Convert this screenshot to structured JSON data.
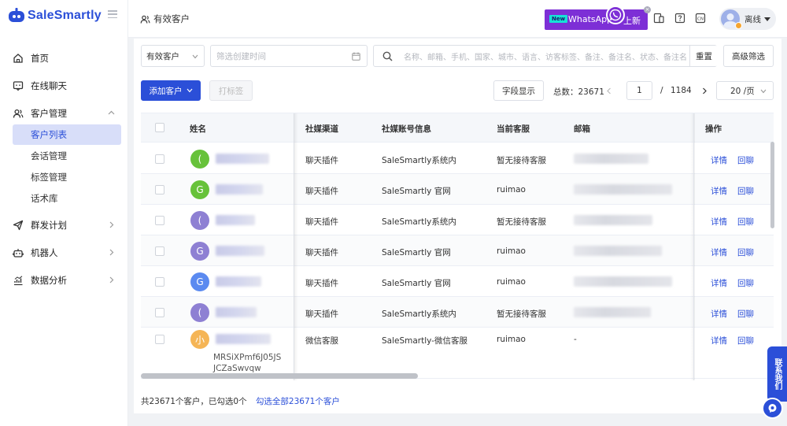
{
  "brand": {
    "name": "SaleSmartly",
    "color": "#2b4fd8"
  },
  "sidebar": {
    "items": [
      {
        "label": "首页",
        "icon": "home-icon"
      },
      {
        "label": "在线聊天",
        "icon": "chat-icon"
      },
      {
        "label": "客户管理",
        "icon": "users-icon",
        "expanded": true,
        "children": [
          "客户列表",
          "会话管理",
          "标签管理",
          "话术库"
        ],
        "active_child": "客户列表"
      },
      {
        "label": "群发计划",
        "icon": "send-icon"
      },
      {
        "label": "机器人",
        "icon": "robot-icon"
      },
      {
        "label": "数据分析",
        "icon": "analytics-icon"
      }
    ]
  },
  "header": {
    "breadcrumb": "有效客户",
    "banner": {
      "badge": "New",
      "text1": "WhatsApp",
      "text2": "上新"
    },
    "status": "离线"
  },
  "filters": {
    "customer_type": "有效客户",
    "date_placeholder": "筛选创建时间",
    "search_placeholder": "名称、邮箱、手机、国家、城市、语言、访客标签、备注、备注名、状态、备注名",
    "reset": "重置",
    "advanced": "高级筛选"
  },
  "toolbar": {
    "add_customer": "添加客户",
    "tag": "打标签",
    "fields": "字段显示",
    "total_label": "总数：",
    "total": "23671",
    "page": "1",
    "page_sep": "/",
    "total_pages": "1184",
    "page_size": "20 /页"
  },
  "table": {
    "headers": [
      "姓名",
      "社媒渠道",
      "社媒账号信息",
      "当前客服",
      "邮箱",
      "操作"
    ],
    "action_detail": "详情",
    "action_reply": "回聊",
    "rows": [
      {
        "initial": "(",
        "color": "#67c23a",
        "channel": "聊天插件",
        "account": "SaleSmartly系统内",
        "agent": "暂无接待客服",
        "email": ""
      },
      {
        "initial": "G",
        "color": "#67c23a",
        "channel": "聊天插件",
        "account": "SaleSmartly 官网",
        "agent": "ruimao",
        "email": ""
      },
      {
        "initial": "(",
        "color": "#8e80d3",
        "channel": "聊天插件",
        "account": "SaleSmartly系统内",
        "agent": "暂无接待客服",
        "email": ""
      },
      {
        "initial": "G",
        "color": "#8e80d3",
        "channel": "聊天插件",
        "account": "SaleSmartly 官网",
        "agent": "ruimao",
        "email": ""
      },
      {
        "initial": "G",
        "color": "#5b8af0",
        "channel": "聊天插件",
        "account": "SaleSmartly 官网",
        "agent": "ruimao",
        "email": ""
      },
      {
        "initial": "(",
        "color": "#8e80d3",
        "channel": "聊天插件",
        "account": "SaleSmartly系统内",
        "agent": "暂无接待客服",
        "email": ""
      },
      {
        "initial": "小",
        "color": "#f5b556",
        "channel": "微信客服",
        "account": "SaleSmartly-微信客服",
        "agent": "ruimao",
        "email": "-",
        "sub_name": "MRSiXPmf6J05JS\nJCZaSwvqw"
      }
    ]
  },
  "footer": {
    "summary": "共23671个客户，已勾选0个",
    "select_all": "勾选全部23671个客户"
  },
  "contact_tab": "联系我们"
}
